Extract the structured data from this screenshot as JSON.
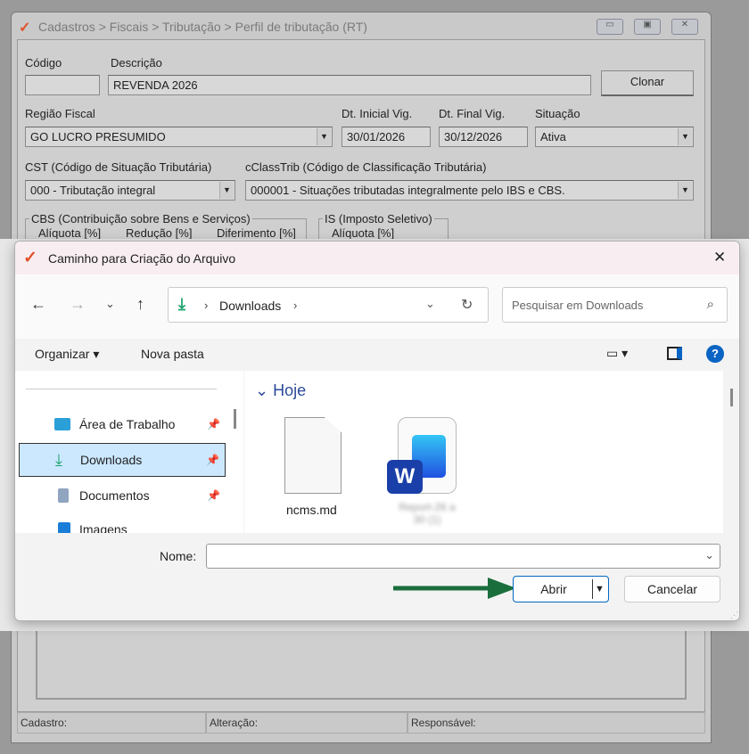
{
  "bg_window": {
    "title": "Cadastros > Fiscais > Tributação > Perfil de tributação (RT)",
    "codigo_label": "Código",
    "codigo_value": "",
    "descricao_label": "Descrição",
    "descricao_value": "REVENDA 2026",
    "clonar": "Clonar",
    "regiao_label": "Região Fiscal",
    "regiao_value": "GO LUCRO PRESUMIDO",
    "dt_inicial_label": "Dt. Inicial Vig.",
    "dt_inicial_value": "30/01/2026",
    "dt_final_label": "Dt. Final Vig.",
    "dt_final_value": "30/12/2026",
    "situacao_label": "Situação",
    "situacao_value": "Ativa",
    "cst_label": "CST (Código de Situação Tributária)",
    "cst_value": "000 - Tributação integral",
    "cclass_label": "cClassTrib (Código de Classificação Tributária)",
    "cclass_value": "000001 - Situações tributadas integralmente pelo IBS e CBS.",
    "cbs_group": "CBS (Contribuição sobre Bens e Serviços)",
    "cbs_cols": [
      "Alíquota [%]",
      "Redução [%]",
      "Diferimento [%]"
    ],
    "is_group": "IS (Imposto Seletivo)",
    "is_cols": [
      "Alíquota [%]"
    ],
    "status": {
      "cadastro": "Cadastro:",
      "alteracao": "Alteração:",
      "responsavel": "Responsável:"
    }
  },
  "dialog": {
    "title": "Caminho para Criação do Arquivo",
    "path": [
      "Downloads"
    ],
    "search_placeholder": "Pesquisar em Downloads",
    "organizar": "Organizar",
    "nova_pasta": "Nova pasta",
    "sidebar": [
      {
        "label": "Área de Trabalho"
      },
      {
        "label": "Downloads",
        "selected": true
      },
      {
        "label": "Documentos"
      },
      {
        "label": "Imagens"
      }
    ],
    "group": "Hoje",
    "files": [
      {
        "name": "ncms.md"
      },
      {
        "name": "Report-26 a 30 (1)",
        "blurred": true
      }
    ],
    "nome_label": "Nome:",
    "nome_value": "",
    "abrir": "Abrir",
    "cancelar": "Cancelar"
  },
  "colors": {
    "accent": "#0067c0",
    "arrow": "#1a6e3c",
    "selected": "#cce8ff"
  }
}
